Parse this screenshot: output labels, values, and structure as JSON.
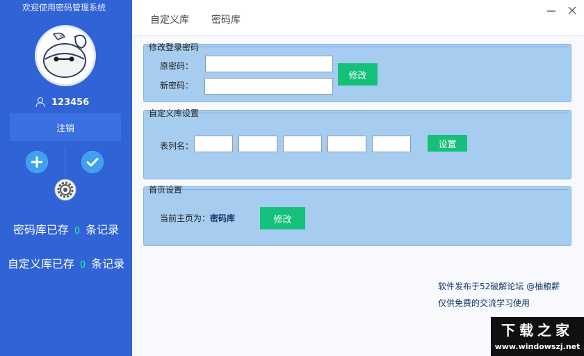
{
  "app": {
    "title": "欢迎使用密码管理系统"
  },
  "user": {
    "name": "123456",
    "logout_label": "注销"
  },
  "stats": {
    "password_lib_prefix": "密码库已存",
    "password_lib_count": "0",
    "custom_lib_prefix": "自定义库已存",
    "custom_lib_count": "0",
    "suffix": "条记录"
  },
  "tabs": [
    {
      "label": "自定义库"
    },
    {
      "label": "密码库"
    }
  ],
  "login_panel": {
    "title": "修改登录密码",
    "old_label": "原密码：",
    "new_label": "新密码：",
    "old_value": "",
    "new_value": "",
    "submit_label": "修改"
  },
  "custom_panel": {
    "title": "自定义库设置",
    "columns_label": "表列名：",
    "columns": [
      "",
      "",
      "",
      "",
      ""
    ],
    "submit_label": "设置"
  },
  "home_panel": {
    "title": "首页设置",
    "current_label": "当前主页为：",
    "current_value": "密码库",
    "submit_label": "修改"
  },
  "footer": {
    "line1": "软件发布于52破解论坛 @柚粮薪",
    "line2": "仅供免费的交流学习使用"
  },
  "watermark": {
    "title": "下载之家",
    "url": "www.windowszj.net"
  },
  "colors": {
    "sidebar": "#2f63d6",
    "accent_green": "#14c07a",
    "panel": "#a6cdf0",
    "count_green": "#2ef0a0"
  },
  "icons": [
    "user-icon",
    "add-icon",
    "check-icon",
    "gear-icon",
    "minimize-icon",
    "close-icon"
  ]
}
